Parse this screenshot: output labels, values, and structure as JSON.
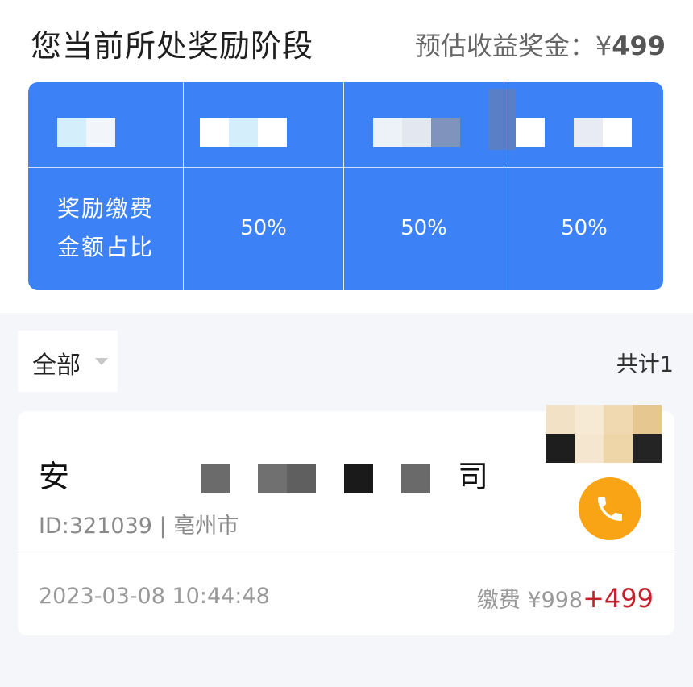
{
  "header": {
    "title": "您当前所处奖励阶段",
    "estimate_label": "预估收益奖金：",
    "estimate_currency": "¥",
    "estimate_amount": "499"
  },
  "reward_table": {
    "row_label_line1": "奖励缴费",
    "row_label_line2": "金额占比",
    "values": [
      "50%",
      "50%",
      "50%"
    ],
    "accent_color": "#3c82f6"
  },
  "filter": {
    "label": "全部",
    "total_text": "共计1"
  },
  "record": {
    "company_first_char": "安",
    "company_last_char": "司",
    "id_text": "ID:321039",
    "separator": "|",
    "city_text": "亳州市",
    "datetime": "2023-03-08 10:44:48",
    "fee_label": "缴费",
    "fee_currency": "¥",
    "fee_amount": "998",
    "bonus": "+499",
    "bonus_color": "#c6202c",
    "phone_icon": "phone-icon",
    "phone_color": "#f8a414"
  }
}
